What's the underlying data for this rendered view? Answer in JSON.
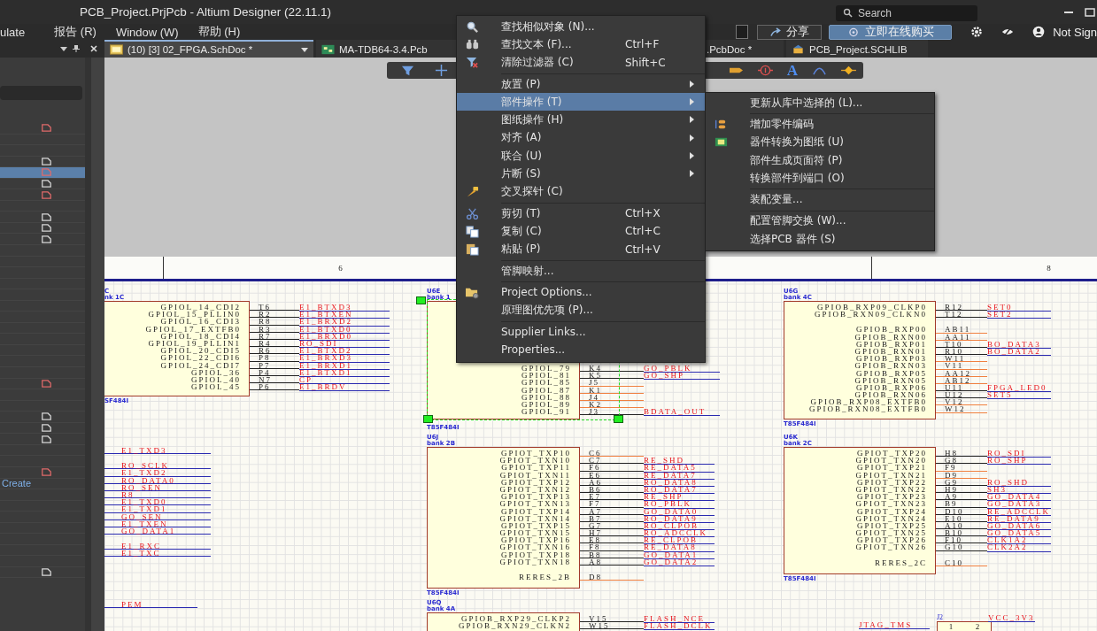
{
  "title_bar": {
    "title": "PCB_Project.PrjPcb - Altium Designer (22.11.1)",
    "search_placeholder": "Search"
  },
  "menu_bar": {
    "items": [
      "ulate",
      "报告 (R)",
      "Window (W)",
      "帮助 (H)"
    ],
    "share_button": "分享",
    "buy_button": "立即在线购买",
    "account": "Not Sign"
  },
  "document_tabs": [
    {
      "label": "(10) [3] 02_FPGA.SchDoc *",
      "selected": true
    },
    {
      "label": "MA-TDB64-3.4.Pcb",
      "selected": false
    },
    {
      "label": ".PcbDoc *",
      "selected": false
    },
    {
      "label": "PCB_Project.SCHLIB",
      "selected": false
    }
  ],
  "panel": {
    "rows": [
      {
        "kind": "modified",
        "selected": false
      },
      {
        "kind": "blank",
        "selected": false
      },
      {
        "kind": "blank",
        "selected": false
      },
      {
        "kind": "saved",
        "selected": false
      },
      {
        "kind": "modified",
        "selected": true
      },
      {
        "kind": "saved",
        "selected": false
      },
      {
        "kind": "modified",
        "selected": false
      },
      {
        "kind": "blank",
        "selected": false
      },
      {
        "kind": "saved",
        "selected": false
      },
      {
        "kind": "saved",
        "selected": false
      },
      {
        "kind": "saved",
        "selected": false
      },
      {
        "kind": "blank",
        "selected": false
      },
      {
        "kind": "blank",
        "selected": false
      },
      {
        "kind": "blank",
        "selected": false
      },
      {
        "kind": "blank",
        "selected": false
      },
      {
        "kind": "blank",
        "selected": false
      },
      {
        "kind": "blank",
        "selected": false
      },
      {
        "kind": "blank",
        "selected": false
      },
      {
        "kind": "blank",
        "selected": false
      },
      {
        "kind": "blank",
        "selected": false
      },
      {
        "kind": "blank",
        "selected": false
      },
      {
        "kind": "blank",
        "selected": false
      },
      {
        "kind": "blank",
        "selected": false
      },
      {
        "kind": "modified",
        "selected": false
      },
      {
        "kind": "blank",
        "selected": false
      },
      {
        "kind": "blank",
        "selected": false
      },
      {
        "kind": "saved",
        "selected": false
      },
      {
        "kind": "saved",
        "selected": false
      },
      {
        "kind": "saved",
        "selected": false
      },
      {
        "kind": "blank",
        "selected": false
      },
      {
        "kind": "blank",
        "selected": false
      },
      {
        "kind": "modified",
        "selected": false
      },
      {
        "kind": "link",
        "label": "Create",
        "selected": false
      },
      {
        "kind": "blank",
        "selected": false
      },
      {
        "kind": "blank",
        "selected": false
      },
      {
        "kind": "blank",
        "selected": false
      },
      {
        "kind": "blank",
        "selected": false
      },
      {
        "kind": "blank",
        "selected": false
      },
      {
        "kind": "blank",
        "selected": false
      },
      {
        "kind": "blank",
        "selected": false
      },
      {
        "kind": "saved",
        "selected": false
      }
    ]
  },
  "toolbar": {
    "text_tool": "A"
  },
  "sheet": {
    "zone_labels": [
      "6",
      "8"
    ],
    "components": [
      {
        "designator": "C",
        "bank": "nk 1C",
        "part": "SF484I",
        "selected": false,
        "pin_groups": [
          [
            {
              "name": "GPIOL_14_CDI2",
              "pin": "T6",
              "net": "E1_BTXD3"
            },
            {
              "name": "GPIOL_15_PLLIN0",
              "pin": "R2",
              "net": "E1_BTXEN"
            },
            {
              "name": "GPIOL_16_CDI3",
              "pin": "R8",
              "net": "E1_BRXD2"
            },
            {
              "name": "GPIOL_17_EXTFB0",
              "pin": "R3",
              "net": "E1_BTXD0"
            },
            {
              "name": "GPIOL_18_CDI4",
              "pin": "R7",
              "net": "E1_BRXD0"
            },
            {
              "name": "GPIOL_19_PLLIN1",
              "pin": "R4",
              "net": "RO_SDI"
            },
            {
              "name": "GPIOL_20_CDI5",
              "pin": "R6",
              "net": "E1_BTXD2"
            },
            {
              "name": "GPIOL_22_CDI6",
              "pin": "P8",
              "net": "E1_BRXD3"
            },
            {
              "name": "GPIOL_24_CDI7",
              "pin": "P7",
              "net": "E1_BRXD1"
            },
            {
              "name": "GPIOL_36",
              "pin": "P4",
              "net": "E1_BTXD1"
            },
            {
              "name": "GPIOL_40",
              "pin": "N7",
              "net": "CP"
            },
            {
              "name": "GPIOL_45",
              "pin": "P6",
              "net": "E1_BRDV"
            }
          ]
        ]
      },
      {
        "designator": "U6E",
        "bank": "bank 1",
        "part": "T85F484I",
        "selected": true,
        "pin_groups": [
          [
            {
              "name": "GPIOL_79",
              "pin": "K4",
              "net": "GO_PBLK"
            },
            {
              "name": "GPIOL_81",
              "pin": "K5",
              "net": "GO_SHP"
            },
            {
              "name": "GPIOL_85",
              "pin": "J5"
            },
            {
              "name": "GPIOL_87",
              "pin": "K1"
            },
            {
              "name": "GPIOL_88",
              "pin": "J4"
            },
            {
              "name": "GPIOL_89",
              "pin": "K2"
            },
            {
              "name": "GPIOL_91",
              "pin": "J3",
              "net": "BDATA_OUT"
            }
          ]
        ]
      },
      {
        "designator": "U6J",
        "bank": "bank 2B",
        "part": "T85F484I",
        "selected": false,
        "pin_groups": [
          [
            {
              "name": "GPIOT_TXP10",
              "pin": "C6"
            },
            {
              "name": "GPIOT_TXN10",
              "pin": "C7",
              "net": "RE_SHD"
            },
            {
              "name": "GPIOT_TXP11",
              "pin": "F6",
              "net": "RE_DATA5"
            },
            {
              "name": "GPIOT_TXN11",
              "pin": "E6",
              "net": "RE_DATA7"
            },
            {
              "name": "GPIOT_TXP12",
              "pin": "A6",
              "net": "RO_DATA8"
            },
            {
              "name": "GPIOT_TXN12",
              "pin": "B6",
              "net": "RO_DATA7"
            },
            {
              "name": "GPIOT_TXP13",
              "pin": "E7",
              "net": "RE_SHP"
            },
            {
              "name": "GPIOT_TXN13",
              "pin": "F7",
              "net": "RO_PBLK"
            },
            {
              "name": "GPIOT_TXP14",
              "pin": "A7",
              "net": "GO_DATA0"
            },
            {
              "name": "GPIOT_TXN14",
              "pin": "B7",
              "net": "RO_DATA9"
            },
            {
              "name": "GPIOT_TXP15",
              "pin": "G7",
              "net": "RO_CLPOB"
            },
            {
              "name": "GPIOT_TXN15",
              "pin": "H7",
              "net": "RO_ADCCLK"
            },
            {
              "name": "GPIOT_TXP16",
              "pin": "E8",
              "net": "RE_CLPOB"
            },
            {
              "name": "GPIOT_TXN16",
              "pin": "F8",
              "net": "RE_DATA8"
            },
            {
              "name": "GPIOT_TXP18",
              "pin": "B8",
              "net": "GO_DATA1"
            },
            {
              "name": "GPIOT_TXN18",
              "pin": "A8",
              "net": "GO_DATA2"
            }
          ],
          [
            {
              "name": "RERES_2B",
              "pin": "D8"
            }
          ]
        ]
      },
      {
        "designator": "U6Q",
        "bank": "bank 4A",
        "selected": false,
        "pin_groups": [
          [
            {
              "name": "GPIOB_RXP29_CLKP2",
              "pin": "V15",
              "net": "FLASH_NCE"
            },
            {
              "name": "GPIOB_RXN29_CLKN2",
              "pin": "W15",
              "net": "FLASH_DCLK"
            }
          ]
        ]
      },
      {
        "designator": "U6G",
        "bank": "bank 4C",
        "part": "T85F484I",
        "selected": false,
        "pin_groups": [
          [
            {
              "name": "GPIOB_RXP09_CLKP0",
              "pin": "R12",
              "net": "SET0"
            },
            {
              "name": "GPIOB_RXN09_CLKN0",
              "pin": "T12",
              "net": "SET2"
            }
          ],
          [
            {
              "name": "GPIOB_RXP00",
              "pin": "AB11"
            },
            {
              "name": "GPIOB_RXN00",
              "pin": "AA11"
            },
            {
              "name": "GPIOB_RXP01",
              "pin": "T10",
              "net": "BO_DATA3"
            },
            {
              "name": "GPIOB_RXN01",
              "pin": "R10",
              "net": "BO_DATA2"
            },
            {
              "name": "GPIOB_RXP03",
              "pin": "W11"
            },
            {
              "name": "GPIOB_RXN03",
              "pin": "V11"
            },
            {
              "name": "GPIOB_RXP05",
              "pin": "AA12"
            },
            {
              "name": "GPIOB_RXN05",
              "pin": "AB12"
            },
            {
              "name": "GPIOB_RXP06",
              "pin": "U11",
              "net": "FPGA_LED0"
            },
            {
              "name": "GPIOB_RXN06",
              "pin": "U12",
              "net": "SET5"
            },
            {
              "name": "GPIOB_RXP08_EXTFB0",
              "pin": "V12"
            },
            {
              "name": "GPIOB_RXN08_EXTFB0",
              "pin": "W12"
            }
          ]
        ]
      },
      {
        "designator": "U6K",
        "bank": "bank 2C",
        "part": "T85F484I",
        "selected": false,
        "pin_groups": [
          [
            {
              "name": "GPIOT_TXP20",
              "pin": "H8",
              "net": "RO_SDI"
            },
            {
              "name": "GPIOT_TXN20",
              "pin": "G8",
              "net": "RO_SHP"
            },
            {
              "name": "GPIOT_TXP21",
              "pin": "F9"
            },
            {
              "name": "GPIOT_TXN21",
              "pin": "D9"
            },
            {
              "name": "GPIOT_TXP22",
              "pin": "G9",
              "net": "RO_SHD"
            },
            {
              "name": "GPIOT_TXN22",
              "pin": "H9",
              "net": "SH3"
            },
            {
              "name": "GPIOT_TXP23",
              "pin": "A9",
              "net": "GO_DATA4"
            },
            {
              "name": "GPIOT_TXN23",
              "pin": "B9",
              "net": "GO_DATA3"
            },
            {
              "name": "GPIOT_TXP24",
              "pin": "D10",
              "net": "RE_ADCCLK"
            },
            {
              "name": "GPIOT_TXN24",
              "pin": "E10",
              "net": "RE_DATA9"
            },
            {
              "name": "GPIOT_TXP25",
              "pin": "A10",
              "net": "GO_DATA6"
            },
            {
              "name": "GPIOT_TXN25",
              "pin": "B10",
              "net": "GO_DATA5"
            },
            {
              "name": "GPIOT_TXP26",
              "pin": "F10",
              "net": "CLK1A2"
            },
            {
              "name": "GPIOT_TXN26",
              "pin": "G10",
              "net": "CLK2A2"
            }
          ],
          [
            {
              "name": "RERES_2C",
              "pin": "C10"
            }
          ]
        ]
      }
    ],
    "net_stubs": [
      {
        "groups": [
          [
            "E1_TXD3"
          ],
          [
            "RO_SCLK",
            "E1_TXD2",
            "RO_DATA0",
            "RO_SEN",
            "R8",
            "E1_TXD0",
            "E1_TXD1",
            "GO_SEN",
            "E1_TXEN",
            "GO_DATA1"
          ],
          [
            "E1_RXC",
            "E1_TXC"
          ]
        ]
      },
      {
        "groups": [
          [
            "PEM"
          ]
        ]
      }
    ],
    "connector": {
      "designator": "J2",
      "pins": [
        "1",
        "2"
      ],
      "nets": [
        "JTAG_TMS",
        "VCC_3V3"
      ]
    }
  },
  "context_menu": {
    "items": [
      {
        "kind": "item",
        "label": "查找相似对象 (N)...",
        "submenu": false,
        "selected": false
      },
      {
        "kind": "item",
        "label": "查找文本 (F)...",
        "shortcut": "Ctrl+F",
        "submenu": false,
        "selected": false
      },
      {
        "kind": "item",
        "label": "清除过滤器 (C)",
        "shortcut": "Shift+C",
        "submenu": false,
        "selected": false
      },
      {
        "kind": "separator"
      },
      {
        "kind": "item",
        "label": "放置 (P)",
        "submenu": true,
        "selected": false
      },
      {
        "kind": "item",
        "label": "部件操作 (T)",
        "submenu": true,
        "selected": true
      },
      {
        "kind": "item",
        "label": "图纸操作 (H)",
        "submenu": true,
        "selected": false
      },
      {
        "kind": "item",
        "label": "对齐 (A)",
        "submenu": true,
        "selected": false
      },
      {
        "kind": "item",
        "label": "联合 (U)",
        "submenu": true,
        "selected": false
      },
      {
        "kind": "item",
        "label": "片断 (S)",
        "submenu": true,
        "selected": false
      },
      {
        "kind": "item",
        "label": "交叉探针 (C)",
        "submenu": false,
        "selected": false
      },
      {
        "kind": "separator"
      },
      {
        "kind": "item",
        "label": "剪切 (T)",
        "shortcut": "Ctrl+X",
        "submenu": false,
        "selected": false
      },
      {
        "kind": "item",
        "label": "复制 (C)",
        "shortcut": "Ctrl+C",
        "submenu": false,
        "selected": false
      },
      {
        "kind": "item",
        "label": "粘贴 (P)",
        "shortcut": "Ctrl+V",
        "submenu": false,
        "selected": false
      },
      {
        "kind": "separator"
      },
      {
        "kind": "item",
        "label": "管脚映射...",
        "submenu": false,
        "selected": false
      },
      {
        "kind": "separator"
      },
      {
        "kind": "item",
        "label": "Project Options...",
        "submenu": false,
        "selected": false
      },
      {
        "kind": "item",
        "label": "原理图优先项 (P)...",
        "submenu": false,
        "selected": false
      },
      {
        "kind": "separator"
      },
      {
        "kind": "item",
        "label": "Supplier Links...",
        "submenu": false,
        "selected": false
      },
      {
        "kind": "item",
        "label": "Properties...",
        "submenu": false,
        "selected": false
      }
    ]
  },
  "submenu": {
    "items": [
      {
        "kind": "item",
        "label": "更新从库中选择的 (L)..."
      },
      {
        "kind": "separator"
      },
      {
        "kind": "item",
        "label": "增加零件编码"
      },
      {
        "kind": "item",
        "label": "器件转换为图纸 (U)"
      },
      {
        "kind": "item",
        "label": "部件生成页面符 (P)"
      },
      {
        "kind": "item",
        "label": "转换部件到端口 (O)"
      },
      {
        "kind": "separator"
      },
      {
        "kind": "item",
        "label": "装配变量..."
      },
      {
        "kind": "separator"
      },
      {
        "kind": "item",
        "label": "配置管脚交换 (W)..."
      },
      {
        "kind": "item",
        "label": "选择PCB 器件 (S)"
      }
    ]
  }
}
